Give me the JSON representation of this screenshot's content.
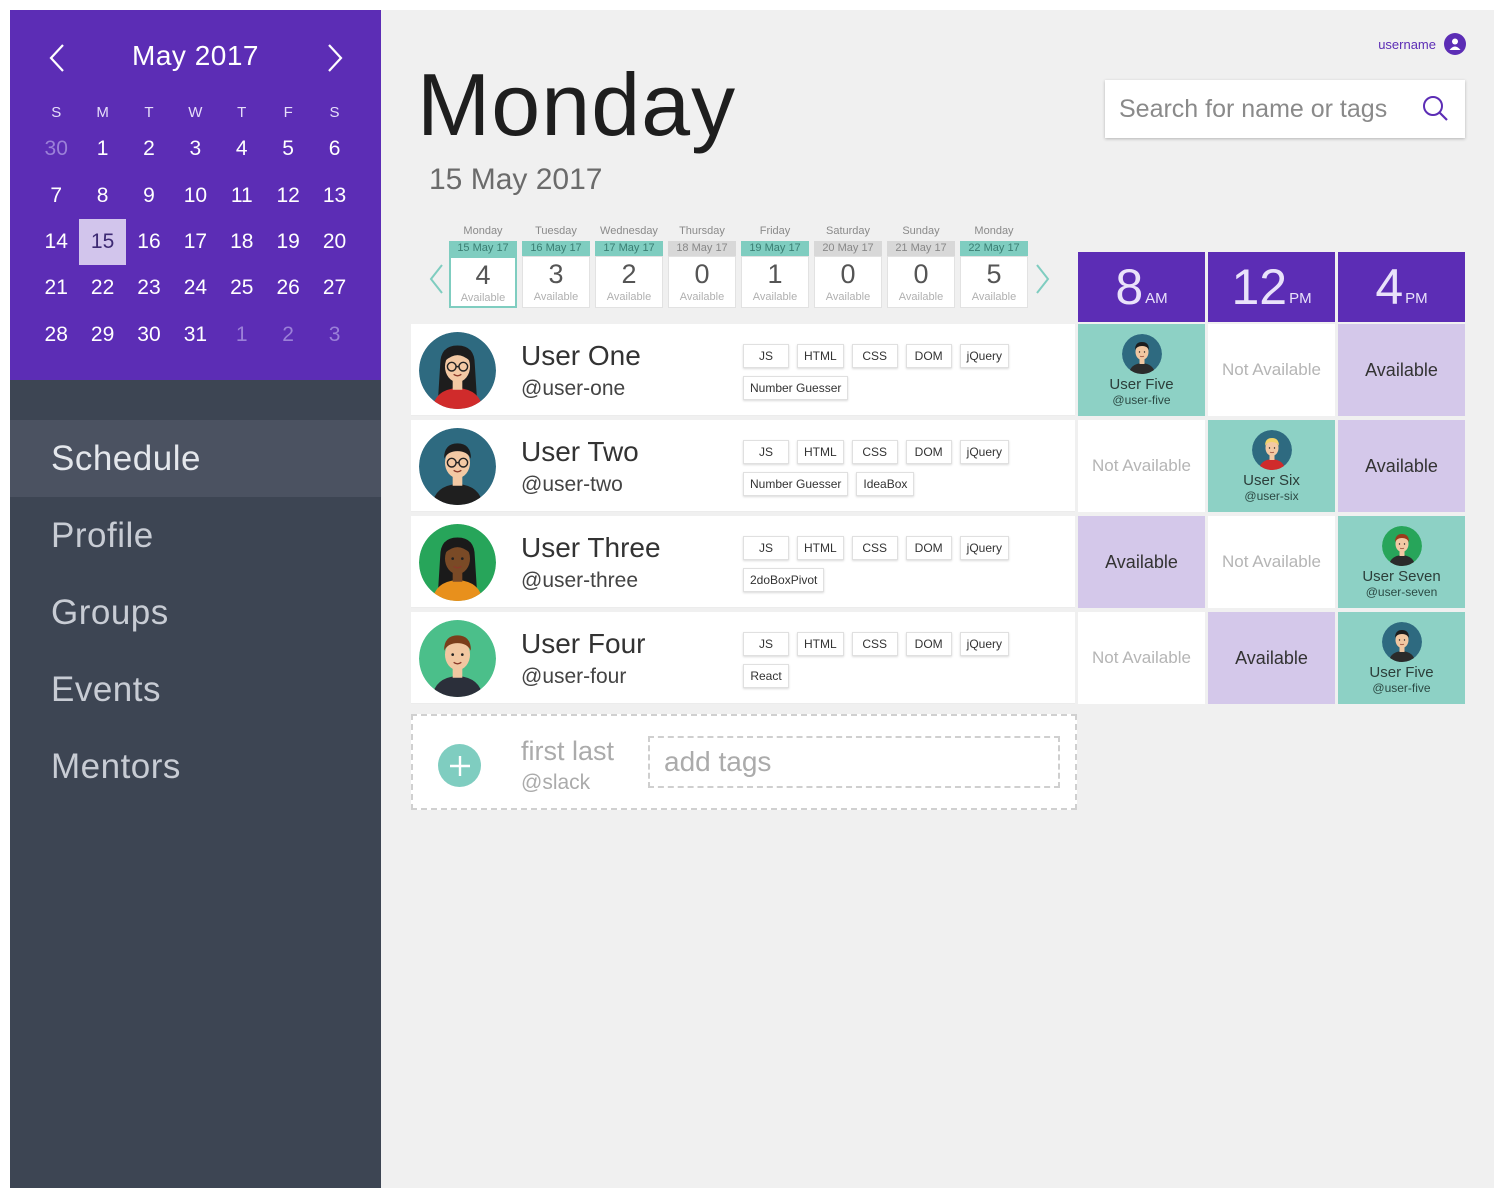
{
  "calendar": {
    "month_title": "May 2017",
    "weekdays": [
      "S",
      "M",
      "T",
      "W",
      "T",
      "F",
      "S"
    ],
    "days": [
      {
        "label": "30",
        "muted": true
      },
      {
        "label": "1"
      },
      {
        "label": "2"
      },
      {
        "label": "3"
      },
      {
        "label": "4"
      },
      {
        "label": "5"
      },
      {
        "label": "6"
      },
      {
        "label": "7"
      },
      {
        "label": "8"
      },
      {
        "label": "9"
      },
      {
        "label": "10"
      },
      {
        "label": "11"
      },
      {
        "label": "12"
      },
      {
        "label": "13"
      },
      {
        "label": "14"
      },
      {
        "label": "15",
        "selected": true
      },
      {
        "label": "16"
      },
      {
        "label": "17"
      },
      {
        "label": "18"
      },
      {
        "label": "19"
      },
      {
        "label": "20"
      },
      {
        "label": "21"
      },
      {
        "label": "22"
      },
      {
        "label": "23"
      },
      {
        "label": "24"
      },
      {
        "label": "25"
      },
      {
        "label": "26"
      },
      {
        "label": "27"
      },
      {
        "label": "28"
      },
      {
        "label": "29"
      },
      {
        "label": "30"
      },
      {
        "label": "31"
      },
      {
        "label": "1",
        "muted": true
      },
      {
        "label": "2",
        "muted": true
      },
      {
        "label": "3",
        "muted": true
      }
    ]
  },
  "nav": {
    "items": [
      {
        "label": "Schedule",
        "active": true
      },
      {
        "label": "Profile"
      },
      {
        "label": "Groups"
      },
      {
        "label": "Events"
      },
      {
        "label": "Mentors"
      }
    ]
  },
  "header": {
    "username": "username",
    "day_title": "Monday",
    "date_subtitle": "15 May 2017",
    "search_placeholder": "Search for name or tags"
  },
  "week": [
    {
      "name": "Monday",
      "date": "15 May 17",
      "count": "4",
      "label": "Available",
      "has_avail": true,
      "current": true
    },
    {
      "name": "Tuesday",
      "date": "16 May 17",
      "count": "3",
      "label": "Available",
      "has_avail": true
    },
    {
      "name": "Wednesday",
      "date": "17 May 17",
      "count": "2",
      "label": "Available",
      "has_avail": true
    },
    {
      "name": "Thursday",
      "date": "18 May 17",
      "count": "0",
      "label": "Available",
      "has_avail": false
    },
    {
      "name": "Friday",
      "date": "19 May 17",
      "count": "1",
      "label": "Available",
      "has_avail": true
    },
    {
      "name": "Saturday",
      "date": "20 May 17",
      "count": "0",
      "label": "Available",
      "has_avail": false
    },
    {
      "name": "Sunday",
      "date": "21 May 17",
      "count": "0",
      "label": "Available",
      "has_avail": false
    },
    {
      "name": "Monday",
      "date": "22 May 17",
      "count": "5",
      "label": "Available",
      "has_avail": true
    }
  ],
  "time_slots": [
    {
      "hour": "8",
      "ampm": "AM"
    },
    {
      "hour": "12",
      "ampm": "PM"
    },
    {
      "hour": "4",
      "ampm": "PM"
    }
  ],
  "users": [
    {
      "name": "User One",
      "handle": "@user-one",
      "avatar_bg": "#2e6a80",
      "skin": "#f3c9a4",
      "hair": "#1d1d1d",
      "shirt": "#d02b2b",
      "glasses": true,
      "long_hair": true,
      "tags": [
        "JS",
        "HTML",
        "CSS",
        "DOM",
        "jQuery",
        "Number Guesser"
      ],
      "slots": [
        {
          "type": "booked",
          "name": "User Five",
          "handle": "@user-five",
          "avatar_bg": "#2e6a80",
          "skin": "#f1c7a1",
          "hair": "#1d1d1d",
          "shirt": "#2b2b2b"
        },
        {
          "type": "na",
          "text": "Not Available"
        },
        {
          "type": "av",
          "text": "Available"
        }
      ]
    },
    {
      "name": "User Two",
      "handle": "@user-two",
      "avatar_bg": "#2e6a80",
      "skin": "#f3c9a4",
      "hair": "#1d1d1d",
      "shirt": "#1f1f1f",
      "glasses": true,
      "long_hair": false,
      "tags": [
        "JS",
        "HTML",
        "CSS",
        "DOM",
        "jQuery",
        "Number Guesser",
        "IdeaBox"
      ],
      "slots": [
        {
          "type": "na",
          "text": "Not Available"
        },
        {
          "type": "booked",
          "name": "User Six",
          "handle": "@user-six",
          "avatar_bg": "#2e6a80",
          "skin": "#f3c9a4",
          "hair": "#f2d36b",
          "shirt": "#d02b2b"
        },
        {
          "type": "av",
          "text": "Available"
        }
      ]
    },
    {
      "name": "User Three",
      "handle": "@user-three",
      "avatar_bg": "#27a55a",
      "skin": "#7a4a26",
      "hair": "#1a1a1a",
      "shirt": "#e8901c",
      "glasses": false,
      "long_hair": true,
      "tags": [
        "JS",
        "HTML",
        "CSS",
        "DOM",
        "jQuery",
        "2doBoxPivot"
      ],
      "slots": [
        {
          "type": "av",
          "text": "Available"
        },
        {
          "type": "na",
          "text": "Not Available"
        },
        {
          "type": "booked",
          "name": "User Seven",
          "handle": "@user-seven",
          "avatar_bg": "#27a55a",
          "skin": "#f3c9a4",
          "hair": "#9b3b1c",
          "shirt": "#2b2b2b"
        }
      ]
    },
    {
      "name": "User Four",
      "handle": "@user-four",
      "avatar_bg": "#4bbf8a",
      "skin": "#f1c7a1",
      "hair": "#7a3e1b",
      "shirt": "#2b2f3a",
      "glasses": false,
      "long_hair": false,
      "tags": [
        "JS",
        "HTML",
        "CSS",
        "DOM",
        "jQuery",
        "React"
      ],
      "slots": [
        {
          "type": "na",
          "text": "Not Available"
        },
        {
          "type": "av",
          "text": "Available"
        },
        {
          "type": "booked",
          "name": "User Five",
          "handle": "@user-five",
          "avatar_bg": "#2e6a80",
          "skin": "#f1c7a1",
          "hair": "#1d1d1d",
          "shirt": "#2b2b2b"
        }
      ]
    }
  ],
  "add_row": {
    "name_placeholder": "first last",
    "slack_placeholder": "@slack",
    "tags_placeholder": "add tags"
  },
  "colors": {
    "purple": "#5c2db5",
    "teal": "#7fcdc0",
    "lavender": "#d4c8ea",
    "sidebar": "#3d4553"
  }
}
